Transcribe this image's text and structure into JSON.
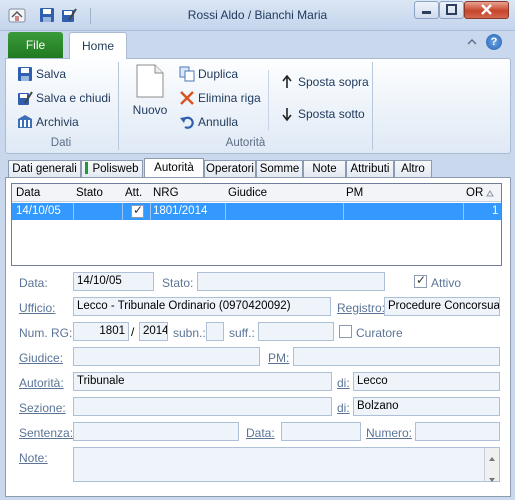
{
  "window": {
    "title": "Rossi Aldo / Bianchi Maria"
  },
  "ribbon": {
    "tabs": {
      "file": "File",
      "home": "Home"
    },
    "groups": {
      "dati": {
        "label": "Dati",
        "salva": "Salva",
        "salva_chiudi": "Salva e chiudi",
        "archivia": "Archivia"
      },
      "autorita": {
        "label": "Autorità",
        "nuovo": "Nuovo",
        "duplica": "Duplica",
        "elimina_riga": "Elimina riga",
        "annulla": "Annulla",
        "sposta_sopra": "Sposta sopra",
        "sposta_sotto": "Sposta sotto"
      }
    }
  },
  "tabs": [
    "Dati generali",
    "Polisweb",
    "Autorità",
    "Operatori",
    "Somme",
    "Note",
    "Attributi",
    "Altro"
  ],
  "grid": {
    "columns": [
      "Data",
      "Stato",
      "Att.",
      "NRG",
      "Giudice",
      "PM",
      "OR"
    ],
    "rows": [
      {
        "data": "14/10/05",
        "stato": "",
        "att": true,
        "nrg": "1801/2014",
        "giudice": "",
        "pm": "",
        "or": "1"
      }
    ]
  },
  "form": {
    "labels": {
      "data": "Data:",
      "stato": "Stato:",
      "attivo": "Attivo",
      "ufficio": "Ufficio:",
      "registro": "Registro:",
      "num_rg": "Num. RG:",
      "slash": "/",
      "subn": "subn.:",
      "suff": "suff.:",
      "curatore": "Curatore",
      "giudice": "Giudice:",
      "pm": "PM:",
      "autorita": "Autorità:",
      "di": "di:",
      "sezione": "Sezione:",
      "di2": "di:",
      "sentenza": "Sentenza:",
      "data2": "Data:",
      "numero": "Numero:",
      "note": "Note:"
    },
    "values": {
      "data": "14/10/05",
      "stato": "",
      "attivo": true,
      "ufficio": "Lecco - Tribunale Ordinario (0970420092)",
      "registro": "Procedure Concorsuali",
      "num_rg": "1801",
      "anno_rg": "2014",
      "subn": "",
      "suff": "",
      "curatore": false,
      "giudice": "",
      "pm": "",
      "autorita": "Tribunale",
      "autorita_di": "Lecco",
      "sezione": "",
      "sezione_di": "Bolzano",
      "sentenza": "",
      "sentenza_data": "",
      "numero": "",
      "note": ""
    }
  },
  "colors": {
    "accent_file": "#2e8b2e",
    "selection": "#3399ff",
    "field_bg": "#eff4fb",
    "label": "#5a7496"
  }
}
